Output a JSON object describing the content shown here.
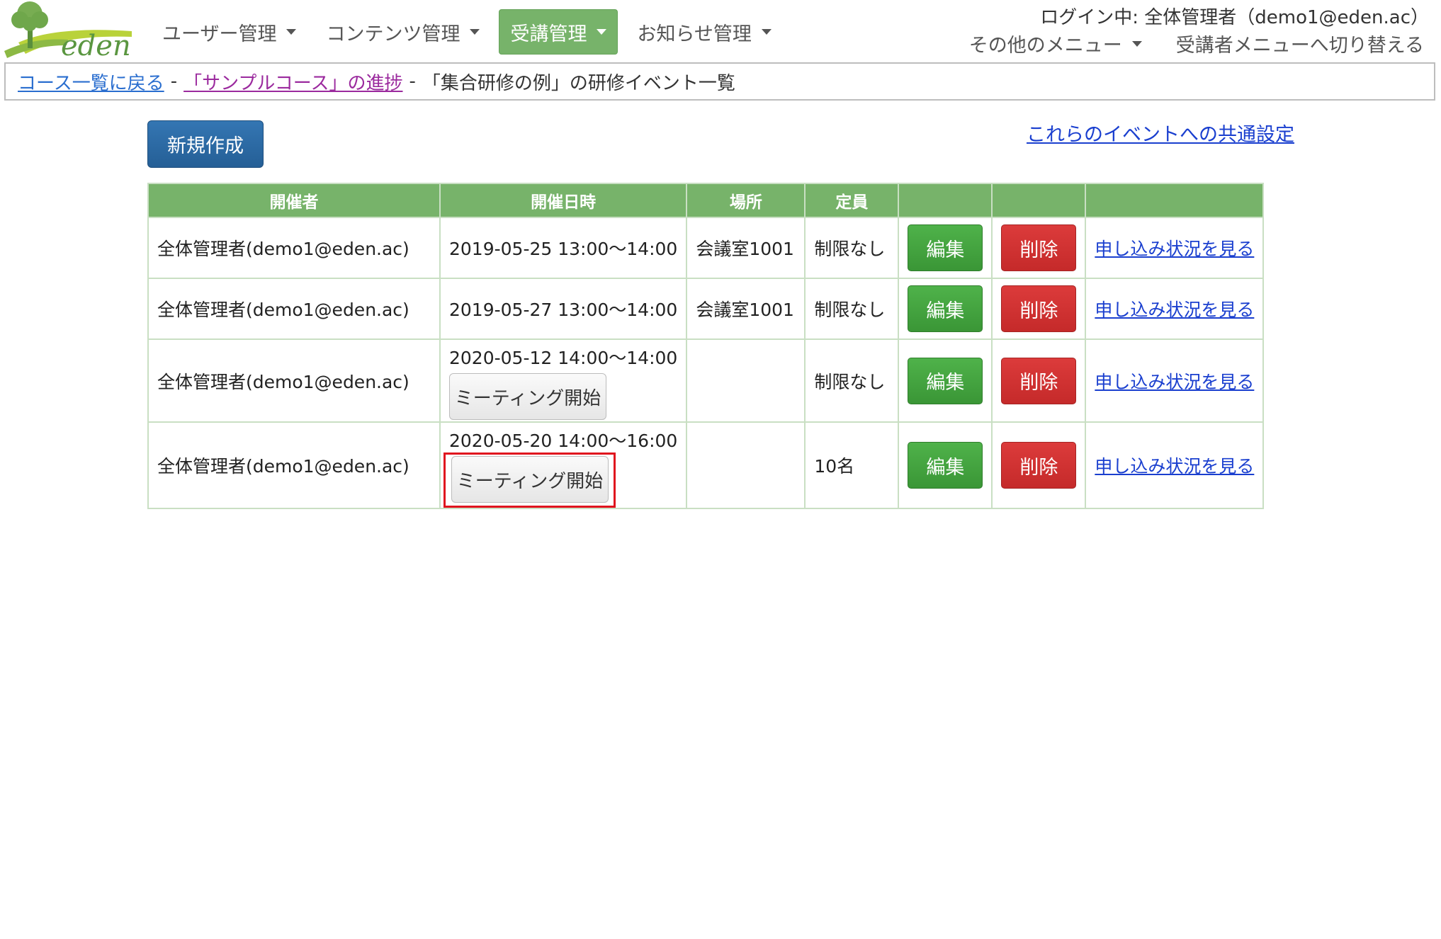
{
  "header": {
    "logo_text": "eden",
    "nav": [
      {
        "label": "ユーザー管理",
        "active": false
      },
      {
        "label": "コンテンツ管理",
        "active": false
      },
      {
        "label": "受講管理",
        "active": true
      },
      {
        "label": "お知らせ管理",
        "active": false
      }
    ],
    "login_info": "ログイン中: 全体管理者（demo1@eden.ac）",
    "other_menu": "その他のメニュー",
    "switch_menu": "受講者メニューへ切り替える"
  },
  "breadcrumb": {
    "back_link": "コース一覧に戻る",
    "sep1": "-",
    "progress_link": "「サンプルコース」の進捗",
    "sep2": "-",
    "current": "「集合研修の例」の研修イベント一覧"
  },
  "actions": {
    "new_button": "新規作成",
    "common_settings_link": "これらのイベントへの共通設定"
  },
  "table": {
    "headers": [
      "開催者",
      "開催日時",
      "場所",
      "定員",
      "",
      "",
      ""
    ],
    "rows": [
      {
        "organizer": "全体管理者(demo1@eden.ac)",
        "datetime": "2019-05-25 13:00～14:00",
        "meeting_button": "",
        "place": "会議室1001",
        "capacity": "制限なし",
        "edit": "編集",
        "delete": "削除",
        "status_link": "申し込み状況を見る"
      },
      {
        "organizer": "全体管理者(demo1@eden.ac)",
        "datetime": "2019-05-27 13:00～14:00",
        "meeting_button": "",
        "place": "会議室1001",
        "capacity": "制限なし",
        "edit": "編集",
        "delete": "削除",
        "status_link": "申し込み状況を見る"
      },
      {
        "organizer": "全体管理者(demo1@eden.ac)",
        "datetime": "2020-05-12 14:00～14:00",
        "meeting_button": "ミーティング開始",
        "place": "",
        "capacity": "制限なし",
        "edit": "編集",
        "delete": "削除",
        "status_link": "申し込み状況を見る"
      },
      {
        "organizer": "全体管理者(demo1@eden.ac)",
        "datetime": "2020-05-20 14:00～16:00",
        "meeting_button": "ミーティング開始",
        "place": "",
        "capacity": "10名",
        "edit": "編集",
        "delete": "削除",
        "status_link": "申し込み状況を見る"
      }
    ]
  },
  "colors": {
    "brand_green": "#77b36a",
    "primary_blue": "#2d6ca8",
    "edit_green": "#45a540",
    "delete_red": "#d03333",
    "highlight_red": "#e0141e"
  }
}
